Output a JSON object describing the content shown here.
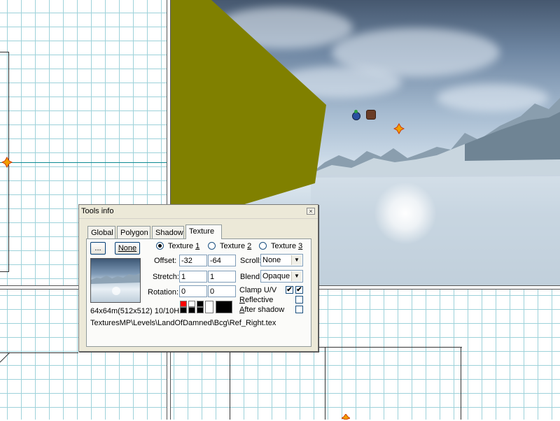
{
  "window": {
    "title": "Tools info",
    "close_glyph": "×",
    "tabs": [
      {
        "label": "Global",
        "active": false
      },
      {
        "label": "Polygon",
        "active": false
      },
      {
        "label": "Shadow",
        "active": false
      },
      {
        "label": "Texture",
        "active": true
      }
    ],
    "texture": {
      "browse_label": "...",
      "none_label": "None",
      "radios": [
        {
          "prefix": "Texture ",
          "digit": "1",
          "selected": true
        },
        {
          "prefix": "Texture ",
          "digit": "2",
          "selected": false
        },
        {
          "prefix": "Texture ",
          "digit": "3",
          "selected": false
        }
      ],
      "offset_label": "Offset:",
      "offset_u": "-32",
      "offset_v": "-64",
      "stretch_label": "Stretch:",
      "stretch_u": "1",
      "stretch_v": "1",
      "rotation_label": "Rotation:",
      "rotation_u": "0",
      "rotation_v": "0",
      "scroll_label": "Scroll:",
      "scroll_value": "None",
      "blend_label": "Blend:",
      "blend_value": "Opaque",
      "clamp_label": "Clamp U/V",
      "clamp_u": true,
      "clamp_v": true,
      "reflective_first": "R",
      "reflective_rest": "eflective",
      "reflective_checked": false,
      "after_shadow_first": "A",
      "after_shadow_rest": "fter shadow",
      "after_shadow_checked": false,
      "size_info": "64x64m(512x512) 10/10H",
      "path": "TexturesMP\\Levels\\LandOfDamned\\Bcg\\Ref_Right.tex",
      "arrow_glyph": "▼",
      "check_glyph": "✔"
    }
  },
  "colors": {
    "olive_polygon": "#808000",
    "grid_line": "#9ed2da",
    "axis_line": "#0c8a93",
    "swatch_red": "#ff0000"
  },
  "viewports": {
    "top_left": "orthographic grid view",
    "bottom_left": "orthographic grid view",
    "bottom_right": "orthographic grid view",
    "top_right": "3d perspective view"
  }
}
